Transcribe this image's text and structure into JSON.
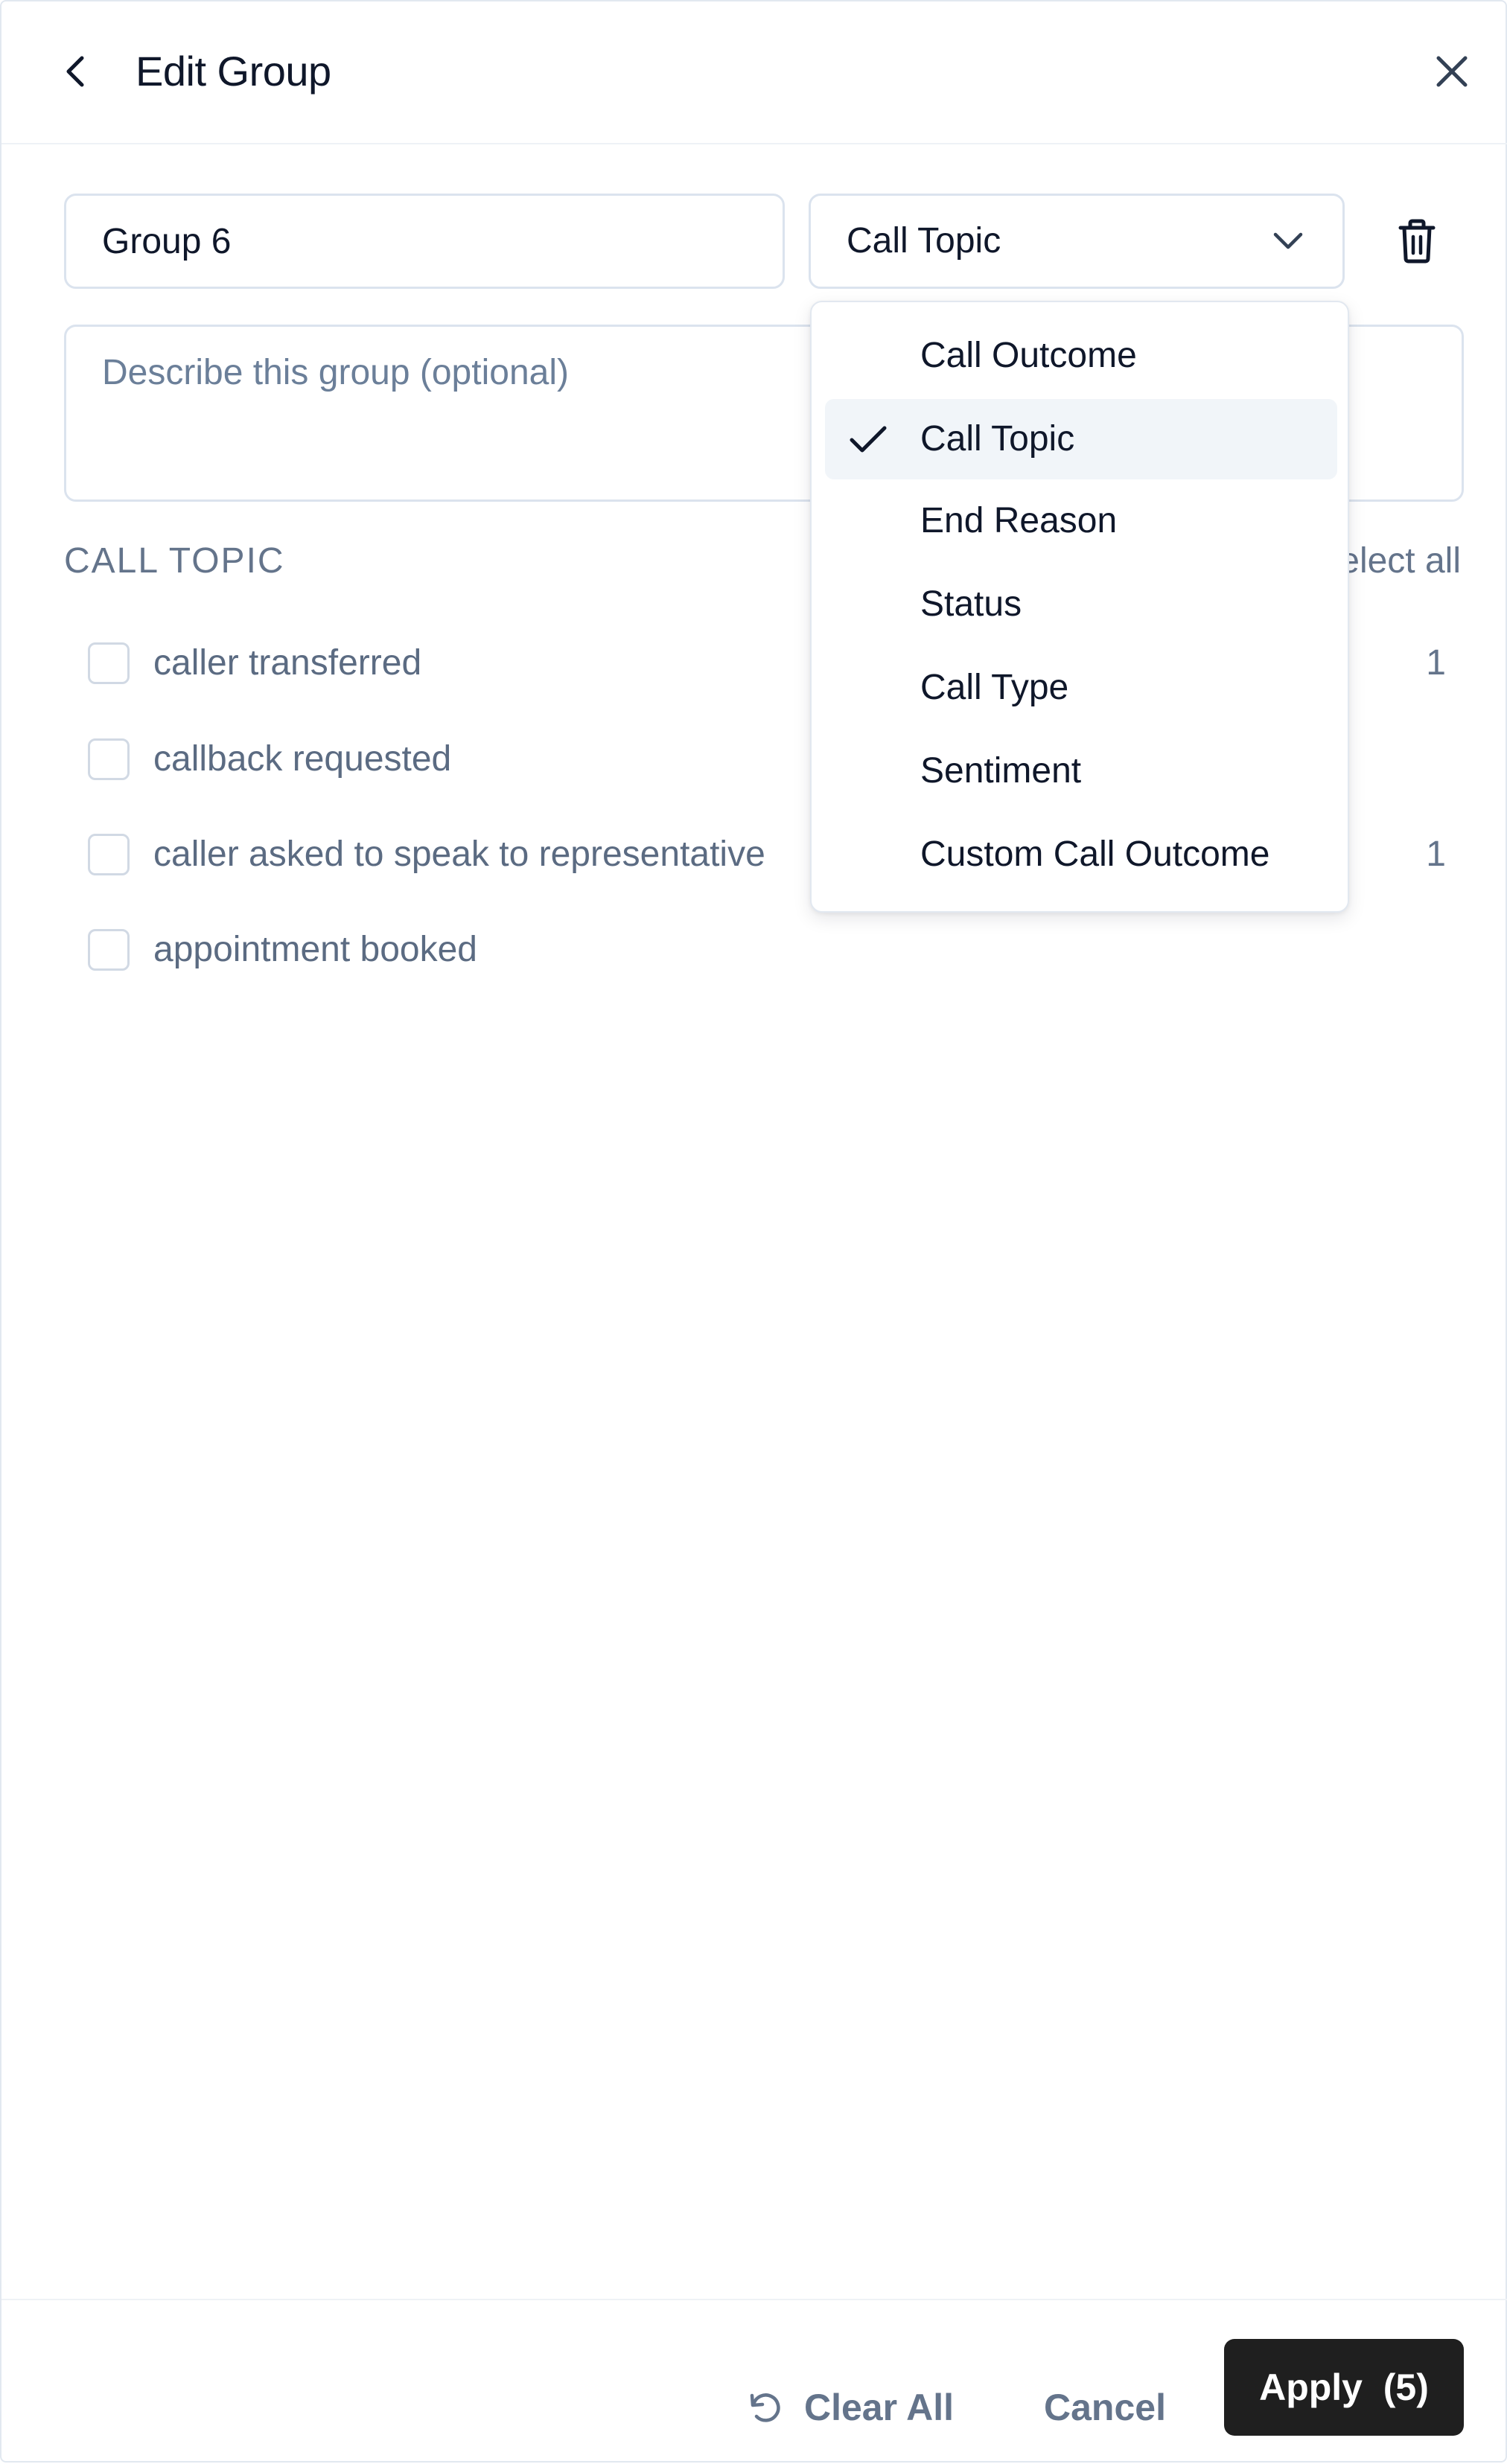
{
  "header": {
    "title": "Edit Group"
  },
  "group": {
    "name_value": "Group 6",
    "description_placeholder": "Describe this group (optional)",
    "type_selected": "Call Topic"
  },
  "section": {
    "label": "CALL TOPIC",
    "select_all_label": "Select all"
  },
  "options": [
    {
      "label": "caller transferred",
      "count": "1"
    },
    {
      "label": "callback requested",
      "count": ""
    },
    {
      "label": "caller asked to speak to representative",
      "count": "1"
    },
    {
      "label": "appointment booked",
      "count": ""
    }
  ],
  "menu": {
    "items": [
      {
        "label": "Call Outcome",
        "selected": false
      },
      {
        "label": "Call Topic",
        "selected": true
      },
      {
        "label": "End Reason",
        "selected": false
      },
      {
        "label": "Status",
        "selected": false
      },
      {
        "label": "Call Type",
        "selected": false
      },
      {
        "label": "Sentiment",
        "selected": false
      },
      {
        "label": "Custom Call Outcome",
        "selected": false
      }
    ]
  },
  "footer": {
    "clear_label": "Clear All",
    "cancel_label": "Cancel",
    "apply_label": "Apply  (5)"
  },
  "icons": {
    "back": "chevron-left-icon",
    "close": "close-icon",
    "chevron": "chevron-down-icon",
    "delete": "trash-icon",
    "check": "check-icon",
    "reset": "rotate-ccw-icon"
  },
  "colors": {
    "apply_bg": "#1f1f1f",
    "menu_selected_bg": "#f1f5f9",
    "border": "#dbe3ee",
    "muted_text": "#64748b"
  }
}
